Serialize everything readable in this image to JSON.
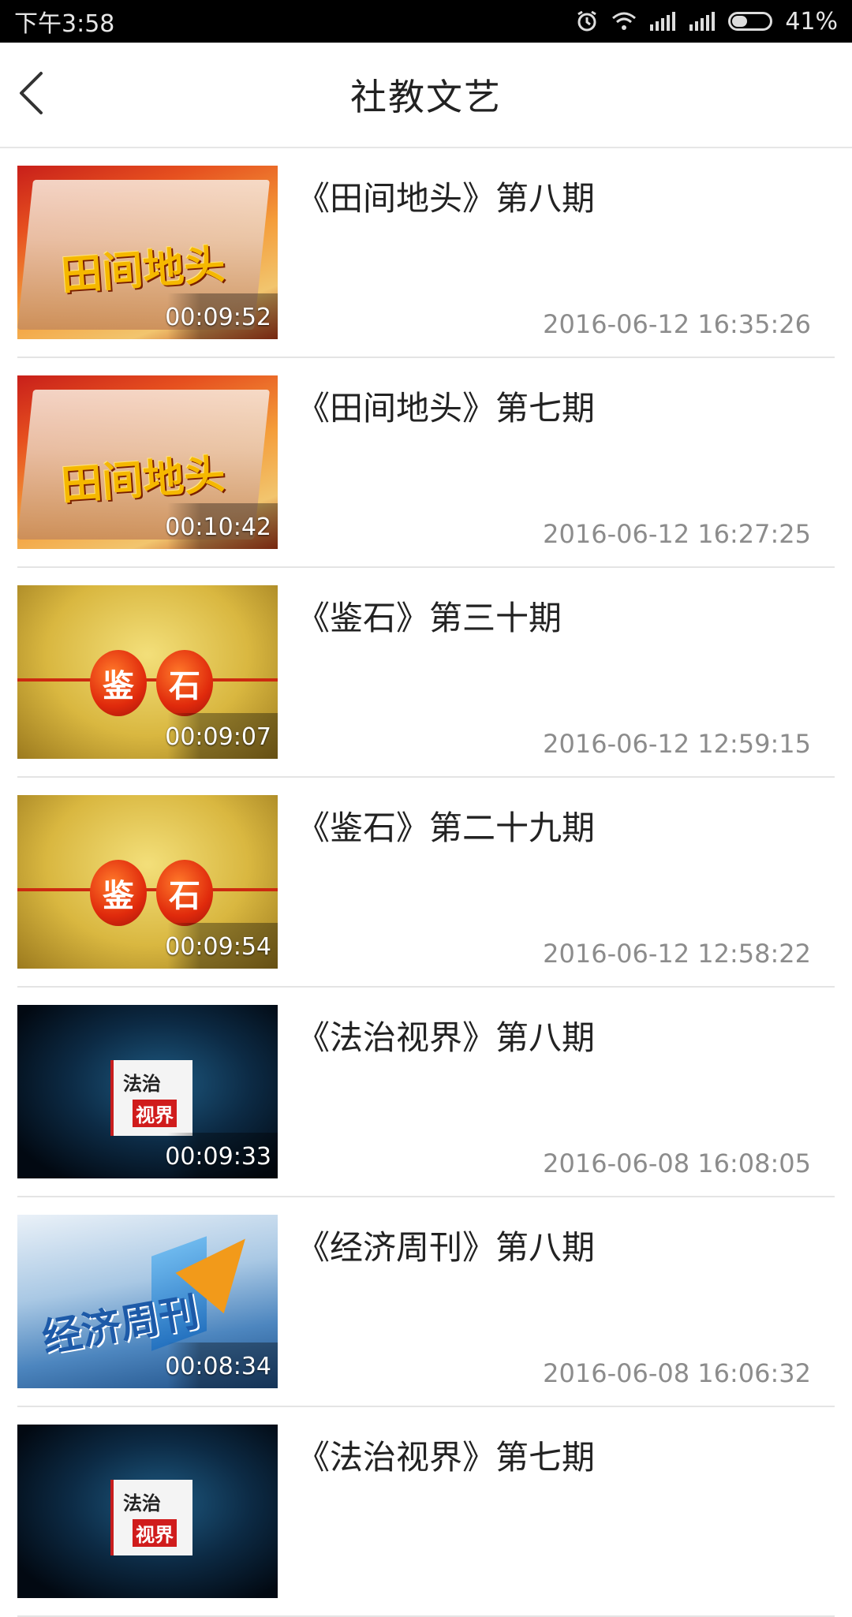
{
  "status_bar": {
    "time": "下午3:58",
    "battery": "41%",
    "battery_level": 0.41,
    "icons": [
      "alarm-icon",
      "wifi-icon",
      "signal-icon",
      "signal-icon",
      "battery-icon"
    ]
  },
  "header": {
    "title": "社教文艺",
    "back_icon": "chevron-left-icon"
  },
  "thumb_text": {
    "tianjian": "田间地头",
    "jianshi_a": "鉴",
    "jianshi_b": "石",
    "fazhi_a": "法治",
    "fazhi_b": "视界",
    "jingji": "经济周刊"
  },
  "items": [
    {
      "title": "《田间地头》第八期",
      "duration": "00:09:52",
      "date": "2016-06-12 16:35:26"
    },
    {
      "title": "《田间地头》第七期",
      "duration": "00:10:42",
      "date": "2016-06-12 16:27:25"
    },
    {
      "title": "《鉴石》第三十期",
      "duration": "00:09:07",
      "date": "2016-06-12 12:59:15"
    },
    {
      "title": "《鉴石》第二十九期",
      "duration": "00:09:54",
      "date": "2016-06-12 12:58:22"
    },
    {
      "title": "《法治视界》第八期",
      "duration": "00:09:33",
      "date": "2016-06-08 16:08:05"
    },
    {
      "title": "《经济周刊》第八期",
      "duration": "00:08:34",
      "date": "2016-06-08 16:06:32"
    },
    {
      "title": "《法治视界》第七期",
      "duration": "",
      "date": ""
    }
  ]
}
